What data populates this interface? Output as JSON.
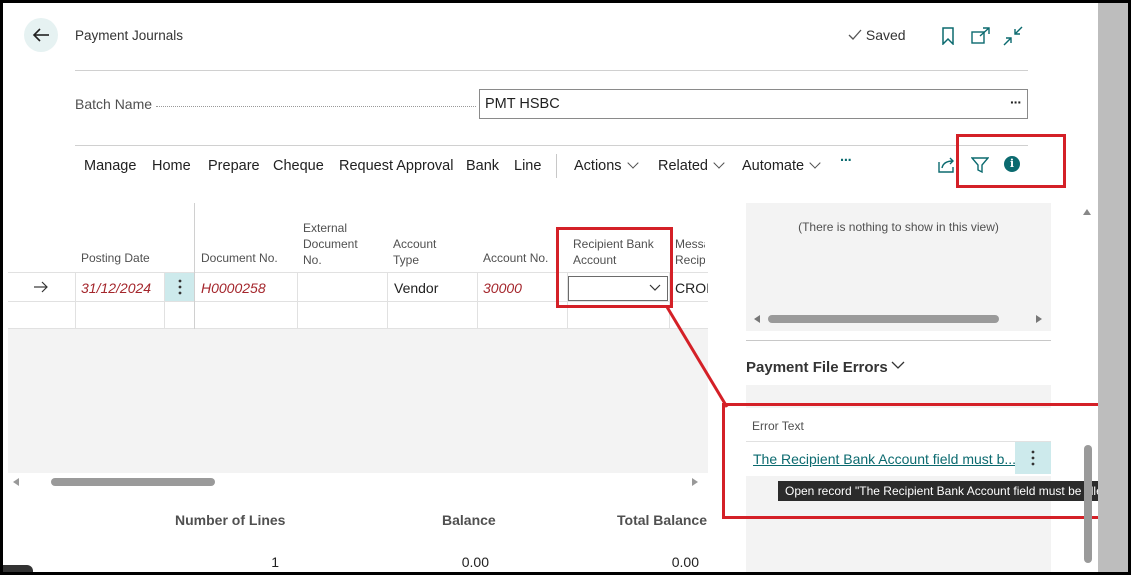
{
  "page": {
    "title": "Payment Journals",
    "saved_status": "Saved",
    "icons": {
      "back": "back-arrow-icon",
      "bookmark": "bookmark-icon",
      "open_new": "open-in-new-window-icon",
      "collapse": "collapse-icon"
    }
  },
  "batch": {
    "label": "Batch Name",
    "value": "PMT HSBC",
    "more": "···"
  },
  "actionbar": {
    "items": [
      "Manage",
      "Home",
      "Prepare",
      "Cheque",
      "Request Approval",
      "Bank",
      "Line"
    ],
    "dropdowns": [
      "Actions",
      "Related",
      "Automate"
    ],
    "more": "···"
  },
  "table": {
    "columns": {
      "posting_date": "Posting Date",
      "document_no": "Document No.",
      "external_1": "External",
      "external_2": "Document",
      "external_3": "No.",
      "account_type_1": "Account",
      "account_type_2": "Type",
      "account_no": "Account No.",
      "recipient_1": "Recipient Bank",
      "recipient_2": "Account",
      "message_1": "Messa",
      "message_2": "Recipi"
    },
    "row": {
      "posting_date": "31/12/2024",
      "document_no": "H0000258",
      "account_type": "Vendor",
      "account_no": "30000",
      "recipient_bank_account": "",
      "message": "CROI"
    }
  },
  "totals": {
    "lines_label": "Number of Lines",
    "lines_value": "1",
    "balance_label": "Balance",
    "balance_value": "0.00",
    "total_balance_label": "Total Balance",
    "total_balance_value": "0.00"
  },
  "factbox": {
    "empty_message": "(There is nothing to show in this view)",
    "errors_title": "Payment File Errors",
    "error_col": "Error Text",
    "error_link": "The Recipient Bank Account field must b...",
    "tooltip": "Open record \"The Recipient Bank Account field must be filled.\""
  },
  "colors": {
    "accent": "#00a2ad",
    "highlight": "#d42027",
    "error_text": "#a4262c",
    "link": "#0b6a6f"
  }
}
